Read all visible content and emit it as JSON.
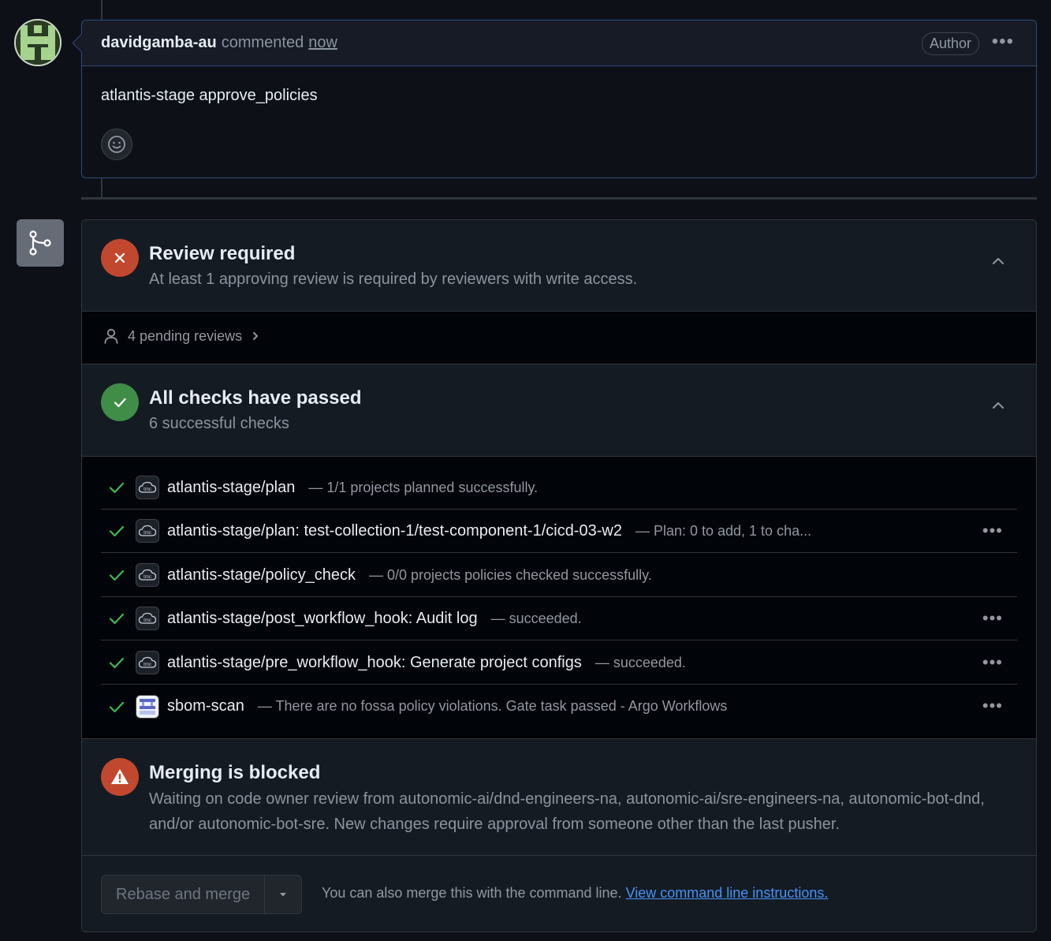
{
  "comment": {
    "author": "davidgamba-au",
    "action": "commented",
    "time": "now",
    "badge": "Author",
    "body": "atlantis-stage approve_policies"
  },
  "review": {
    "title": "Review required",
    "subtitle": "At least 1 approving review is required by reviewers with write access.",
    "pending": "4 pending reviews"
  },
  "checks": {
    "title": "All checks have passed",
    "subtitle": "6 successful checks",
    "items": [
      {
        "name": "atlantis-stage/plan",
        "desc": "— 1/1 projects planned successfully.",
        "icon": "tmc"
      },
      {
        "name": "atlantis-stage/plan: test-collection-1/test-component-1/cicd-03-w2",
        "desc": "— Plan: 0 to add, 1 to cha...",
        "icon": "tmc"
      },
      {
        "name": "atlantis-stage/policy_check",
        "desc": "— 0/0 projects policies checked successfully.",
        "icon": "tmc"
      },
      {
        "name": "atlantis-stage/post_workflow_hook: Audit log",
        "desc": "— succeeded.",
        "icon": "tmc"
      },
      {
        "name": "atlantis-stage/pre_workflow_hook: Generate project configs",
        "desc": "— succeeded.",
        "icon": "tmc"
      },
      {
        "name": "sbom-scan",
        "desc": "— There are no fossa policy violations. Gate task passed - Argo Workflows",
        "icon": "sbom"
      }
    ]
  },
  "blocked": {
    "title": "Merging is blocked",
    "subtitle": "Waiting on code owner review from autonomic-ai/dnd-engineers-na, autonomic-ai/sre-engineers-na, autonomic-bot-dnd, and/or autonomic-bot-sre. New changes require approval from someone other than the last pusher."
  },
  "merge": {
    "button": "Rebase and merge",
    "note": "You can also merge this with the command line.",
    "link": "View command line instructions."
  },
  "icons": {
    "tmc_label": "tmc"
  },
  "colors": {
    "background": "#0d1117",
    "danger": "#c1482f",
    "success": "#3f8d47",
    "link": "#4493f8"
  }
}
